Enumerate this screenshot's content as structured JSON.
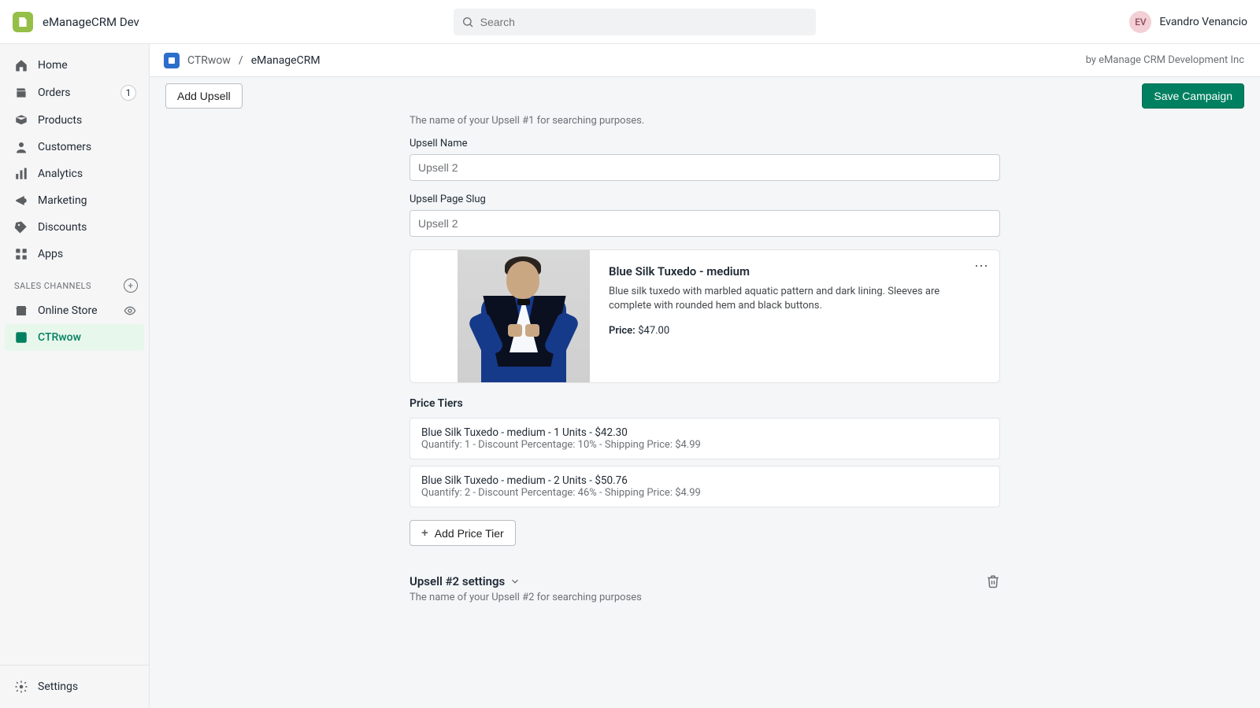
{
  "topbar": {
    "store_name": "eManageCRM Dev",
    "search_placeholder": "Search",
    "user_initials": "EV",
    "user_name": "Evandro Venancio"
  },
  "sidebar": {
    "items": [
      {
        "label": "Home"
      },
      {
        "label": "Orders",
        "badge": "1"
      },
      {
        "label": "Products"
      },
      {
        "label": "Customers"
      },
      {
        "label": "Analytics"
      },
      {
        "label": "Marketing"
      },
      {
        "label": "Discounts"
      },
      {
        "label": "Apps"
      }
    ],
    "section_label": "SALES CHANNELS",
    "channels": [
      {
        "label": "Online Store"
      },
      {
        "label": "CTRwow"
      }
    ],
    "settings_label": "Settings"
  },
  "app": {
    "breadcrumb_root": "CTRwow",
    "breadcrumb_sep": "/",
    "breadcrumb_leaf": "eManageCRM",
    "by_line": "by eManage CRM Development Inc",
    "add_upsell_label": "Add Upsell",
    "save_label": "Save Campaign"
  },
  "form": {
    "helper": "The name of your Upsell #1 for searching purposes.",
    "name_label": "Upsell Name",
    "name_value": "Upsell 2",
    "slug_label": "Upsell Page Slug",
    "slug_value": "Upsell 2"
  },
  "product": {
    "title": "Blue Silk Tuxedo - medium",
    "description": "Blue silk tuxedo with marbled aquatic pattern and dark lining. Sleeves are complete with rounded hem and black buttons.",
    "price_label": "Price:",
    "price_value": "$47.00"
  },
  "tiers_heading": "Price Tiers",
  "tiers": [
    {
      "title": "Blue Silk Tuxedo - medium - 1 Units - $42.30",
      "sub": "Quantify: 1 - Discount Percentage: 10% - Shipping Price: $4.99"
    },
    {
      "title": "Blue Silk Tuxedo - medium - 2 Units - $50.76",
      "sub": "Quantify: 2 - Discount Percentage: 46% - Shipping Price: $4.99"
    }
  ],
  "add_tier_label": "Add Price Tier",
  "upsell2": {
    "title": "Upsell #2 settings",
    "helper": "The name of your Upsell #2 for searching purposes"
  }
}
